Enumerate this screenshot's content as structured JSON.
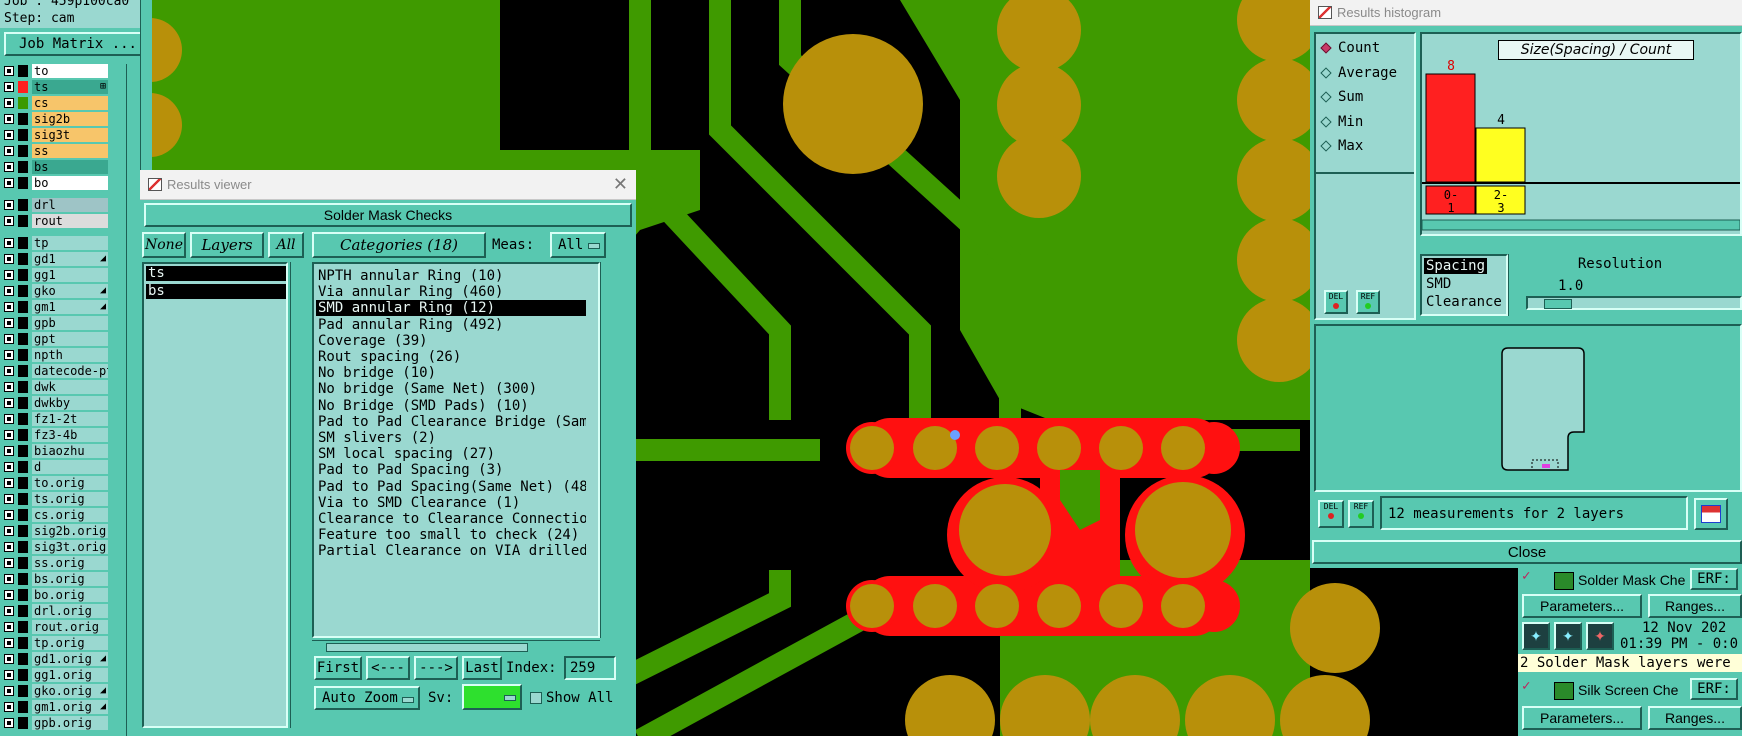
{
  "left_panel": {
    "job_label": "Job : 459p100ca0",
    "step_label": "Step: cam",
    "job_matrix_button": "Job Matrix ...",
    "layers_top": [
      {
        "name": "to",
        "color": "#ffffff",
        "swatch": "#000000"
      },
      {
        "name": "ts",
        "color": "#3aa890",
        "swatch": "#ff2020",
        "marker": "⊞"
      },
      {
        "name": "cs",
        "color": "#f7c56a",
        "swatch": "#3b9a00"
      },
      {
        "name": "sig2b",
        "color": "#f7c56a",
        "swatch": "#000000"
      },
      {
        "name": "sig3t",
        "color": "#f7c56a",
        "swatch": "#000000"
      },
      {
        "name": "ss",
        "color": "#f7c56a",
        "swatch": "#000000"
      },
      {
        "name": "bs",
        "color": "#3aa890",
        "swatch": "#000000"
      },
      {
        "name": "bo",
        "color": "#ffffff",
        "swatch": "#000000"
      }
    ],
    "layers_drill": [
      {
        "name": "drl",
        "color": "#9ec4c6",
        "swatch": "#000000"
      },
      {
        "name": "rout",
        "color": "#dcdcdc",
        "swatch": "#000000"
      }
    ],
    "layers_misc": [
      {
        "name": "tp",
        "color": "#9ad8d0",
        "swatch": "#000000"
      },
      {
        "name": "gd1",
        "color": "#9ad8d0",
        "swatch": "#000000",
        "marker": "◢"
      },
      {
        "name": "gg1",
        "color": "#9ad8d0",
        "swatch": "#000000"
      },
      {
        "name": "gko",
        "color": "#9ad8d0",
        "swatch": "#000000",
        "marker": "◢"
      },
      {
        "name": "gm1",
        "color": "#9ad8d0",
        "swatch": "#000000",
        "marker": "◢"
      },
      {
        "name": "gpb",
        "color": "#9ad8d0",
        "swatch": "#000000"
      },
      {
        "name": "gpt",
        "color": "#9ad8d0",
        "swatch": "#000000"
      },
      {
        "name": "npth",
        "color": "#9ad8d0",
        "swatch": "#000000"
      },
      {
        "name": "datecode-pt",
        "color": "#9ad8d0",
        "swatch": "#000000"
      },
      {
        "name": "dwk",
        "color": "#9ad8d0",
        "swatch": "#000000"
      },
      {
        "name": "dwkby",
        "color": "#9ad8d0",
        "swatch": "#000000"
      },
      {
        "name": "fz1-2t",
        "color": "#9ad8d0",
        "swatch": "#000000"
      },
      {
        "name": "fz3-4b",
        "color": "#9ad8d0",
        "swatch": "#000000"
      },
      {
        "name": "biaozhu",
        "color": "#9ad8d0",
        "swatch": "#000000"
      },
      {
        "name": "d",
        "color": "#9ad8d0",
        "swatch": "#000000"
      },
      {
        "name": "to.orig",
        "color": "#9ad8d0",
        "swatch": "#000000"
      },
      {
        "name": "ts.orig",
        "color": "#9ad8d0",
        "swatch": "#000000"
      },
      {
        "name": "cs.orig",
        "color": "#9ad8d0",
        "swatch": "#000000"
      },
      {
        "name": "sig2b.orig",
        "color": "#9ad8d0",
        "swatch": "#000000"
      },
      {
        "name": "sig3t.orig",
        "color": "#9ad8d0",
        "swatch": "#000000"
      },
      {
        "name": "ss.orig",
        "color": "#9ad8d0",
        "swatch": "#000000"
      },
      {
        "name": "bs.orig",
        "color": "#9ad8d0",
        "swatch": "#000000"
      },
      {
        "name": "bo.orig",
        "color": "#9ad8d0",
        "swatch": "#000000"
      },
      {
        "name": "drl.orig",
        "color": "#9ad8d0",
        "swatch": "#000000"
      },
      {
        "name": "rout.orig",
        "color": "#9ad8d0",
        "swatch": "#000000"
      },
      {
        "name": "tp.orig",
        "color": "#9ad8d0",
        "swatch": "#000000"
      },
      {
        "name": "gd1.orig",
        "color": "#9ad8d0",
        "swatch": "#000000",
        "marker": "◢"
      },
      {
        "name": "gg1.orig",
        "color": "#9ad8d0",
        "swatch": "#000000"
      },
      {
        "name": "gko.orig",
        "color": "#9ad8d0",
        "swatch": "#000000",
        "marker": "◢"
      },
      {
        "name": "gm1.orig",
        "color": "#9ad8d0",
        "swatch": "#000000",
        "marker": "◢"
      },
      {
        "name": "gpb.orig",
        "color": "#9ad8d0",
        "swatch": "#000000"
      }
    ]
  },
  "results_viewer": {
    "window_title": "Results viewer",
    "header": "Solder Mask Checks",
    "none_label": "None",
    "layers_label": "Layers",
    "all_label": "All",
    "layer_list": [
      "ts",
      "bs"
    ],
    "categories_label": "Categories (18)",
    "meas_label": "Meas:",
    "meas_value": "All",
    "categories": [
      "NPTH annular Ring (10)",
      "Via annular Ring (460)",
      "SMD annular Ring (12)",
      "Pad annular Ring (492)",
      "Coverage (39)",
      "Rout spacing (26)",
      "No bridge (10)",
      "No bridge (Same Net) (300)",
      "No Bridge (SMD Pads) (10)",
      "Pad to Pad Clearance Bridge (Same",
      "SM slivers (2)",
      "SM local spacing (27)",
      "Pad to Pad Spacing (3)",
      "Pad to Pad Spacing(Same Net) (48)",
      "Via to SMD Clearance (1)",
      "Clearance to Clearance Connectior",
      "Feature too small to check (24)",
      "Partial Clearance on VIA drilled"
    ],
    "selected_category_index": 2,
    "first_label": "First",
    "prev_label": "<---",
    "next_label": "--->",
    "last_label": "Last",
    "index_label": "Index:",
    "index_value": "259",
    "auto_zoom_label": "Auto Zoom",
    "sv_label": "Sv:",
    "show_all_label": "Show All"
  },
  "histogram": {
    "window_title": "Results histogram",
    "modes": [
      "Count",
      "Average",
      "Sum",
      "Min",
      "Max"
    ],
    "selected_mode": "Count",
    "chart_title": "Size(Spacing) / Count",
    "bars": [
      {
        "label": "0-\n1",
        "value": 8,
        "color": "#ff2020"
      },
      {
        "label": "2-\n3",
        "value": 4,
        "color": "#ffff20"
      }
    ],
    "max_value": 8,
    "attr_list": [
      "Spacing",
      "SMD",
      "Clearance"
    ],
    "selected_attr": "Spacing",
    "resolution_label": "Resolution",
    "resolution_value": "1.0",
    "del_label": "DEL",
    "ref_label": "REF",
    "status_text": "12 measurements for 2 layers",
    "close_label": "Close"
  },
  "checklist_panel": {
    "row1_name": "Solder Mask Che",
    "row1_erf": "ERF:",
    "parameters_label": "Parameters...",
    "ranges_label": "Ranges...",
    "date_text": "12 Nov 202",
    "time_text": "01:39 PM - 0:0",
    "message_text": "2 Solder Mask layers were",
    "row2_name": "Silk Screen Che",
    "row2_erf": "ERF:",
    "parameters_label2": "Parameters...",
    "ranges_label2": "Ranges..."
  }
}
